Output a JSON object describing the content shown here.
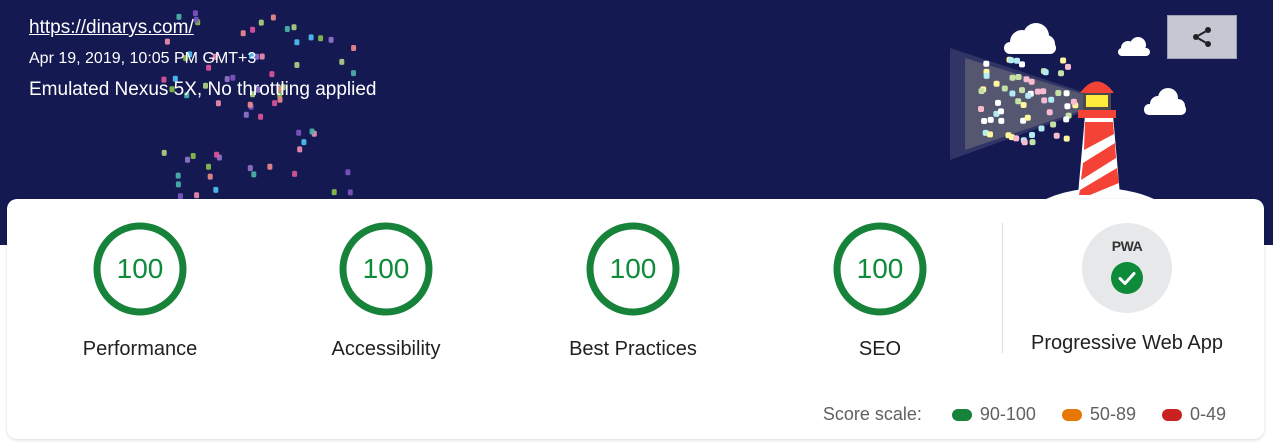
{
  "header": {
    "url": "https://dinarys.com/",
    "timestamp": "Apr 19, 2019, 10:05 PM GMT+3",
    "device": "Emulated Nexus 5X, No throttling applied",
    "share_icon": "share-icon"
  },
  "categories": [
    {
      "label": "Performance",
      "score": "100"
    },
    {
      "label": "Accessibility",
      "score": "100"
    },
    {
      "label": "Best Practices",
      "score": "100"
    },
    {
      "label": "SEO",
      "score": "100"
    }
  ],
  "pwa": {
    "badge_text": "PWA",
    "label": "Progressive Web App",
    "status_icon": "check-icon"
  },
  "score_scale": {
    "title": "Score scale:",
    "ranges": [
      {
        "label": "90-100",
        "color": "#178239"
      },
      {
        "label": "50-89",
        "color": "#e67700"
      },
      {
        "label": "0-49",
        "color": "#c7221f"
      }
    ]
  },
  "colors": {
    "header_bg": "#141951",
    "pass": "#0d8a3a"
  }
}
